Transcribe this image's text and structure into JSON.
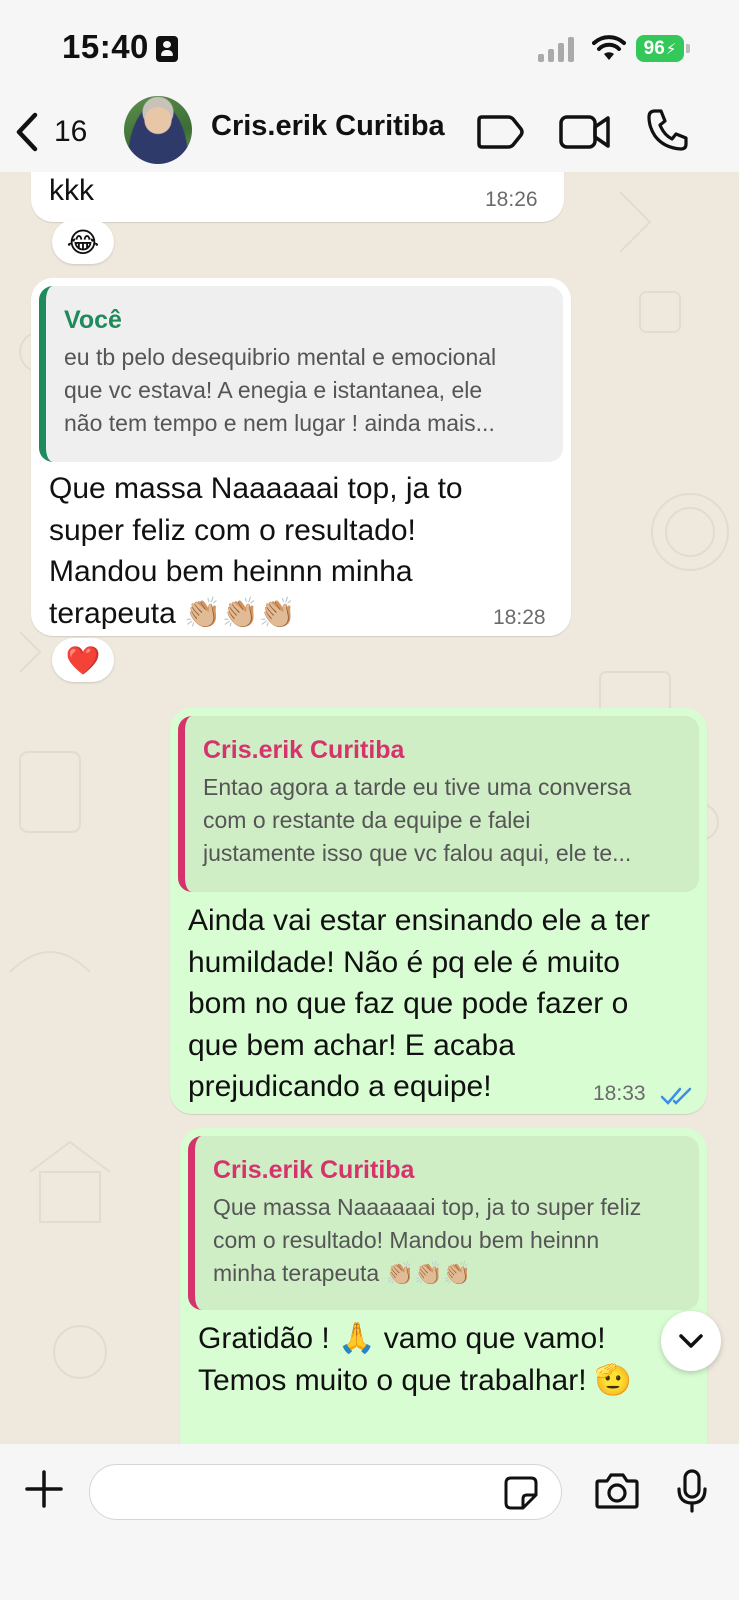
{
  "status_bar": {
    "time": "15:40",
    "battery": "96"
  },
  "header": {
    "back_count": "16",
    "contact_name": "Cris.erik Curitiba",
    "icons": [
      "chevron-left-icon",
      "label-icon",
      "video-call-icon",
      "phone-icon"
    ]
  },
  "messages": [
    {
      "direction": "incoming",
      "text": "kkk",
      "time": "18:26",
      "reaction": "😂"
    },
    {
      "direction": "incoming",
      "quote": {
        "author": "Você",
        "lines": [
          "eu tb pelo desequibrio mental e emocional",
          "que vc estava!  A enegia e istantanea, ele",
          "não tem tempo e nem lugar ! ainda mais..."
        ]
      },
      "lines": [
        "Que massa Naaaaaai top, ja to",
        "super feliz com o resultado!",
        "Mandou bem heinnn minha",
        "terapeuta  👏🏼👏🏼👏🏼"
      ],
      "time": "18:28",
      "reaction": "❤️"
    },
    {
      "direction": "outgoing",
      "quote": {
        "author": "Cris.erik Curitiba",
        "lines": [
          "Entao agora a tarde eu tive uma conversa",
          "com o restante da equipe e falei",
          "justamente isso que vc falou aqui, ele te..."
        ]
      },
      "lines": [
        "Ainda vai estar ensinando ele a ter",
        "humildade! Não é pq ele é muito",
        "bom no que faz que pode fazer o",
        "que bem achar! E acaba",
        "prejudicando a equipe!"
      ],
      "time": "18:33",
      "status": "read"
    },
    {
      "direction": "outgoing",
      "quote": {
        "author": "Cris.erik Curitiba",
        "lines": [
          "Que massa Naaaaaai top, ja to super feliz",
          "com o resultado! Mandou bem heinnn",
          "minha terapeuta  👏🏼👏🏼👏🏼"
        ]
      },
      "lines": [
        "Gratidão ! 🙏 vamo que vamo!",
        "Temos muito o que trabalhar! 🫡"
      ]
    }
  ],
  "input": {
    "placeholder": ""
  },
  "colors": {
    "incoming_bubble": "#ffffff",
    "outgoing_bubble": "#d9fdd3",
    "quote_you": "#1f8a5b",
    "quote_contact": "#d6336c",
    "read_ticks": "#3b8ee8"
  }
}
